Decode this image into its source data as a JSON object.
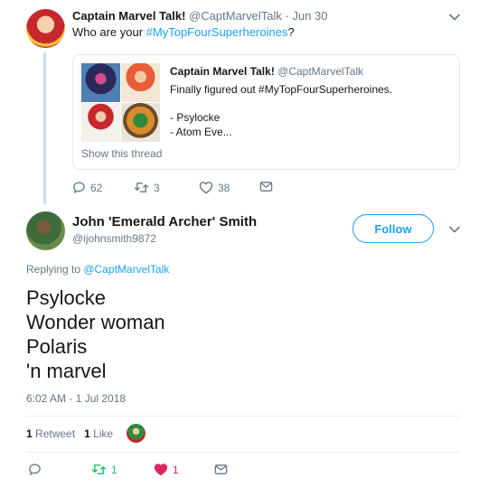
{
  "original": {
    "author_name": "Captain Marvel Talk!",
    "handle": "@CaptMarvelTalk",
    "date": "Jun 30",
    "text_prefix": "Who are your ",
    "hashtag": "#MyTopFourSuperheroines",
    "text_suffix": "?",
    "replies": "62",
    "retweets": "3",
    "likes": "38"
  },
  "quoted": {
    "author_name": "Captain Marvel Talk!",
    "handle": "@CaptMarvelTalk",
    "line1": "Finally figured out #MyTopFourSuperheroines.",
    "line2": "- Psylocke",
    "line3": "- Atom Eve...",
    "show_thread": "Show this thread"
  },
  "reply": {
    "author_name": "John 'Emerald Archer' Smith",
    "handle": "@ijohnsmith9872",
    "follow_label": "Follow",
    "replying_to_prefix": "Replying to ",
    "replying_to_handle": "@CaptMarvelTalk",
    "lines": [
      "Psylocke",
      "Wonder woman",
      "Polaris",
      "'n marvel"
    ],
    "timestamp": "6:02 AM - 1 Jul 2018",
    "retweet_count": "1",
    "retweet_label": "Retweet",
    "like_count": "1",
    "like_label": "Like",
    "bar_retweets": "1",
    "bar_likes": "1"
  },
  "colors": {
    "accent": "#1da1f2",
    "retweet_green": "#17bf63",
    "like_red": "#e0245e",
    "muted": "#657786"
  }
}
